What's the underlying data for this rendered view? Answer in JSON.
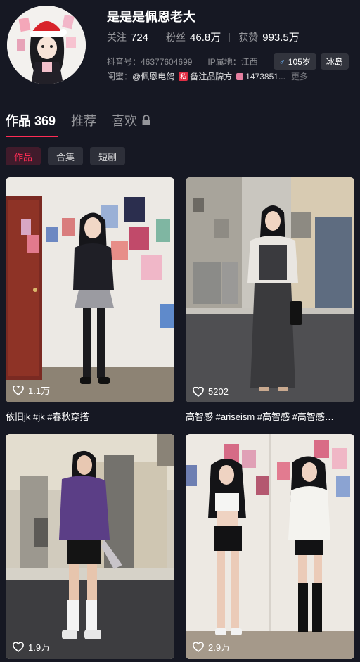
{
  "profile": {
    "name": "是是是佩恩老大",
    "stats": [
      {
        "label": "关注",
        "value": "724"
      },
      {
        "label": "粉丝",
        "value": "46.8万"
      },
      {
        "label": "获赞",
        "value": "993.5万"
      }
    ],
    "douyin_id": "抖音号：46377604699",
    "ip_location": "IP属地：江西",
    "gender_age": "105岁",
    "region_tag": "冰岛",
    "friends_label": "闺蜜：",
    "friend_1": "@佩恩电鸽",
    "friend_2_badge": "私",
    "friend_2": "备注品牌方",
    "friend_3": "1473851...",
    "more": "更多",
    "colors": {
      "accent": "#fe2c55",
      "background": "#161823"
    }
  },
  "tabs": [
    {
      "label": "作品 369",
      "active": true
    },
    {
      "label": "推荐",
      "active": false
    },
    {
      "label": "喜欢",
      "active": false,
      "icon": "lock-icon"
    }
  ],
  "chips": [
    {
      "label": "作品",
      "active": true
    },
    {
      "label": "合集",
      "active": false
    },
    {
      "label": "短剧",
      "active": false
    }
  ],
  "videos": [
    {
      "likes": "1.1万",
      "caption": "依旧jk #jk #春秋穿搭"
    },
    {
      "likes": "5202",
      "caption": "高智感 #ariseism #高智感 #高智感…"
    },
    {
      "likes": "1.9万",
      "caption": ""
    },
    {
      "likes": "2.9万",
      "caption": ""
    }
  ]
}
